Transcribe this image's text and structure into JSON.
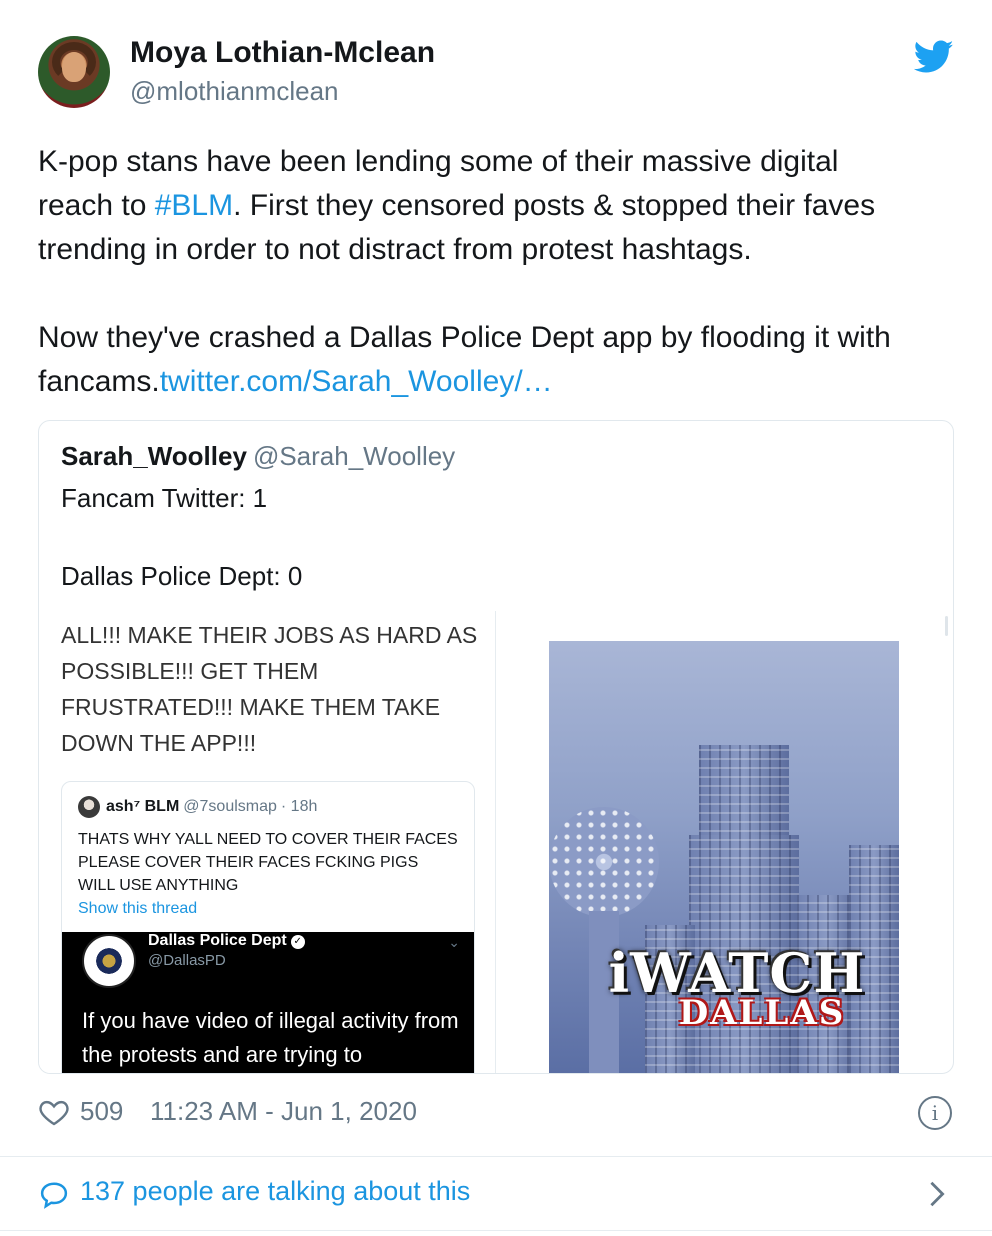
{
  "author": {
    "name": "Moya Lothian-Mclean",
    "handle": "@mlothianmclean"
  },
  "tweet": {
    "line1": "K-pop stans have been lending some of their massive digital",
    "line2_pre": "reach to ",
    "hashtag": "#BLM",
    "line2_post": ". First they censored posts & stopped their faves",
    "line3": "trending in order to not distract from protest hashtags.",
    "line4": "Now they've crashed a Dallas Police Dept app by flooding it with",
    "line5_pre": "fancams.",
    "link": "twitter.com/Sarah_Woolley/…"
  },
  "quote": {
    "name": "Sarah_Woolley",
    "handle": "@Sarah_Woolley",
    "line1": "Fancam Twitter: 1",
    "line2": "Dallas Police Dept: 0",
    "media_left": {
      "text": "ALL!!! MAKE THEIR JOBS AS HARD AS POSSIBLE!!! GET THEM FRUSTRATED!!! MAKE THEM TAKE DOWN THE APP!!!",
      "inner_tweet": {
        "name": "ash⁷ BLM",
        "handle": "@7soulsmap",
        "time": "· 18h",
        "text": "THATS WHY YALL NEED TO COVER THEIR FACES PLEASE COVER THEIR FACES FCKING PIGS WILL USE ANYTHING",
        "show_thread": "Show this thread",
        "embedded": {
          "name": "Dallas Police Dept",
          "handle": "@DallasPD",
          "text": "If you have video of illegal activity from the protests and are trying to"
        }
      }
    },
    "media_right": {
      "title": "iWATCH",
      "subtitle": "DALLAS"
    }
  },
  "footer": {
    "likes": "509",
    "timestamp": "11:23 AM - Jun 1, 2020",
    "talking": "137 people are talking about this"
  },
  "colors": {
    "link": "#1b95e0",
    "muted": "#657786",
    "text": "#14171a"
  },
  "icons": [
    "twitter-bird-icon",
    "heart-icon",
    "info-icon",
    "speech-bubble-icon",
    "chevron-right-icon",
    "verified-icon",
    "chevron-down-icon"
  ]
}
